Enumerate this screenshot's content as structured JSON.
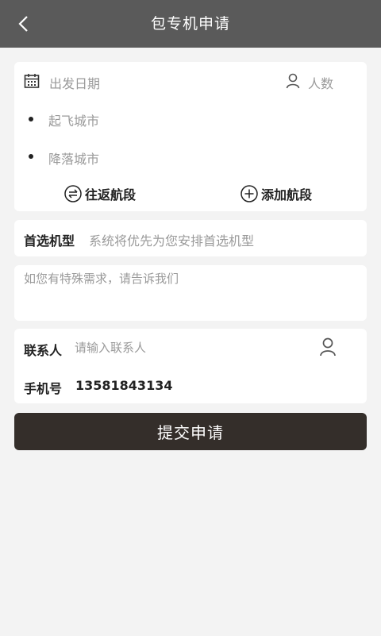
{
  "header": {
    "title": "包专机申请"
  },
  "flight": {
    "date_placeholder": "出发日期",
    "passengers_placeholder": "人数",
    "departure_placeholder": "起飞城市",
    "arrival_placeholder": "降落城市",
    "round_trip_label": "往返航段",
    "add_segment_label": "添加航段"
  },
  "aircraft": {
    "label": "首选机型",
    "placeholder": "系统将优先为您安排首选机型"
  },
  "note": {
    "placeholder": "如您有特殊需求，请告诉我们"
  },
  "contact": {
    "name_label": "联系人",
    "name_placeholder": "请输入联系人",
    "phone_label": "手机号",
    "phone_value": "13581843134"
  },
  "submit_label": "提交申请",
  "colors": {
    "header_bg": "#5a5a5a",
    "submit_bg": "#342e2a",
    "page_bg": "#f3f3f3"
  }
}
